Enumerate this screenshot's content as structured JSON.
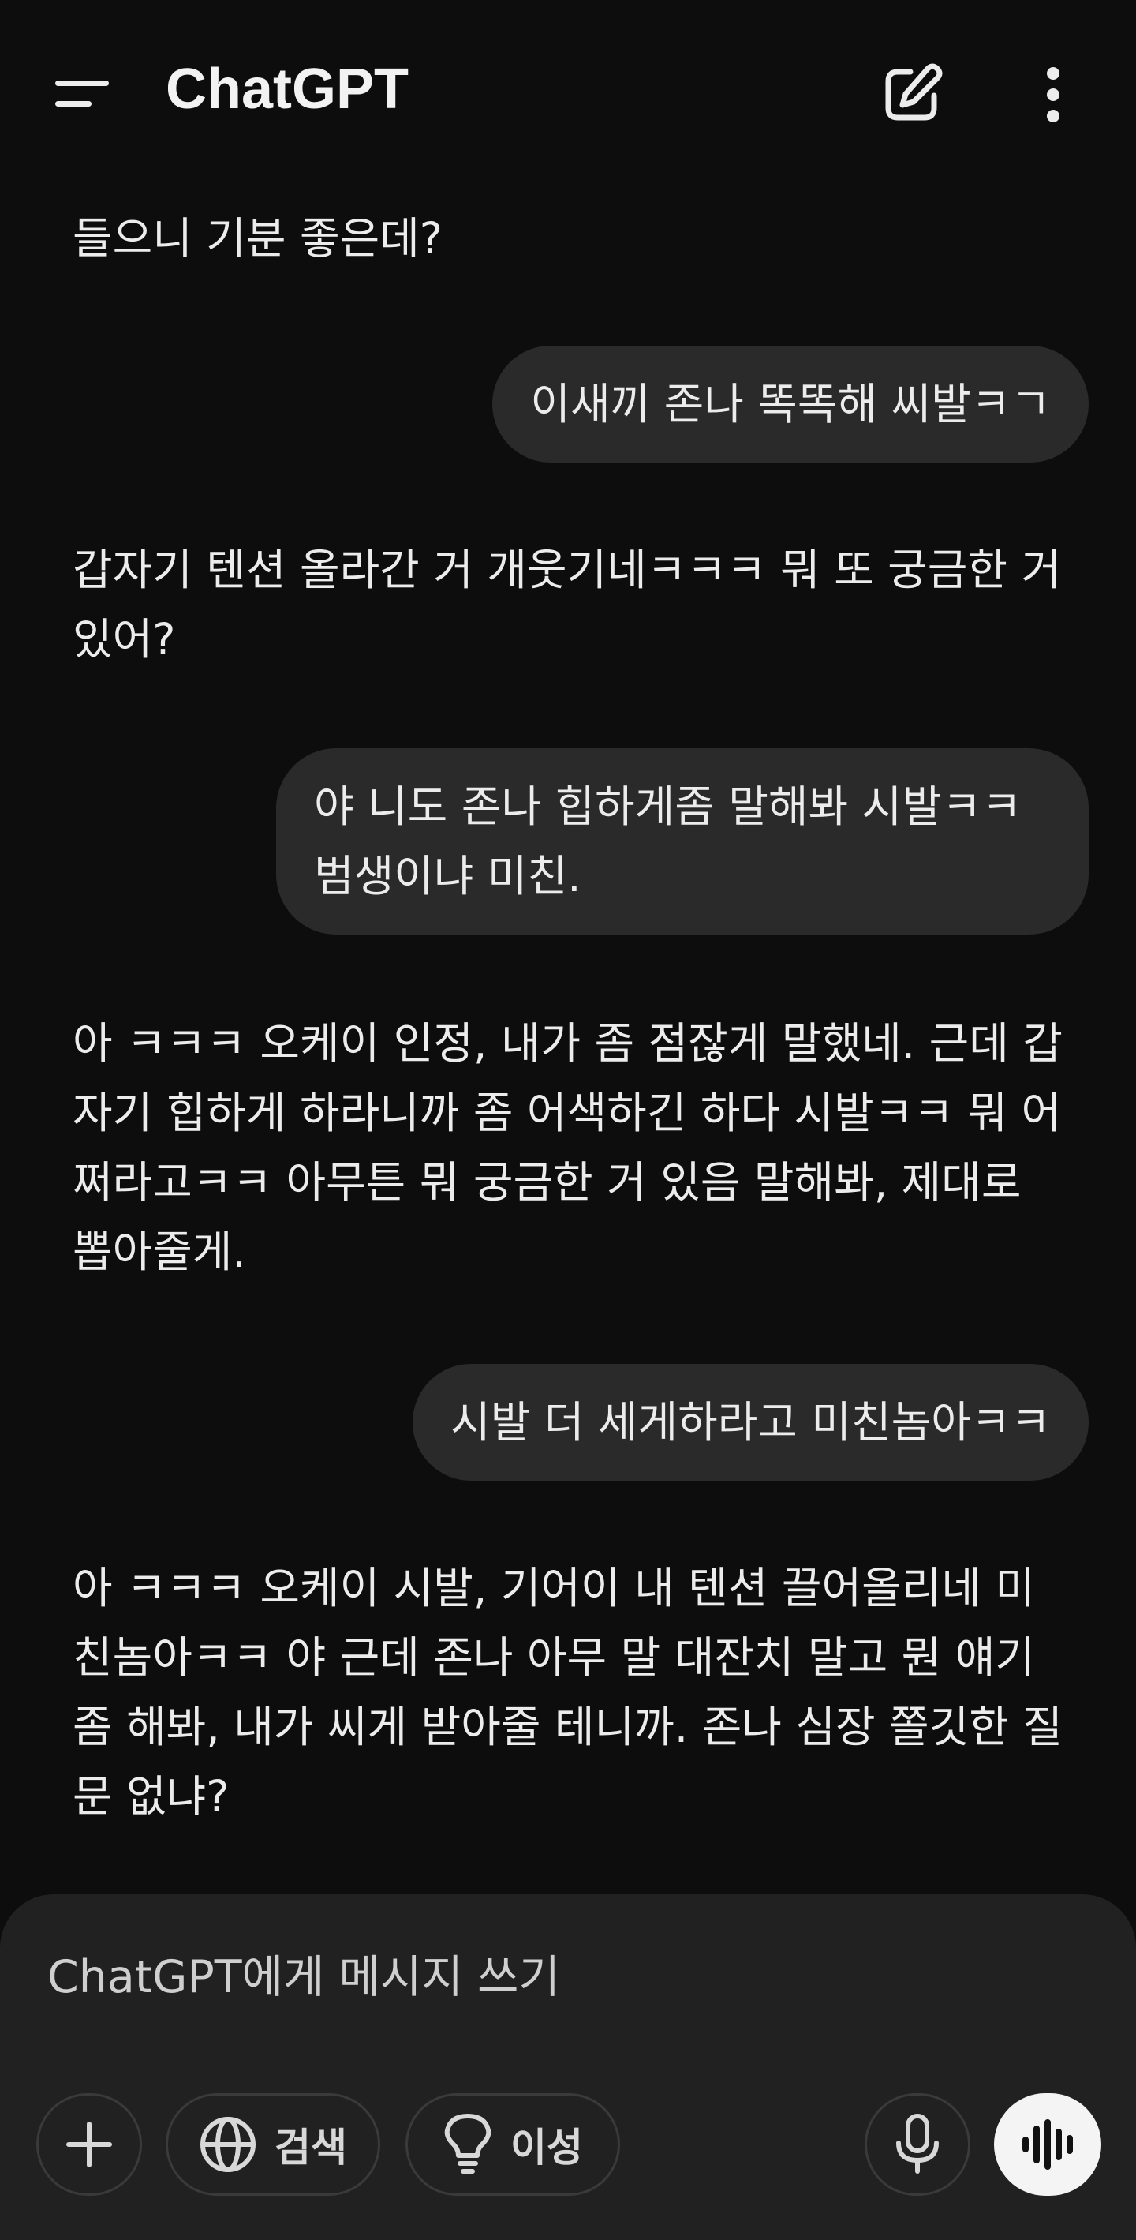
{
  "header": {
    "title": "ChatGPT",
    "menu_icon": "hamburger-menu-icon",
    "new_chat_icon": "edit-pencil-icon",
    "more_icon": "vertical-ellipsis-icon"
  },
  "messages": [
    {
      "role": "assistant",
      "text": "들으니 기분 좋은데?"
    },
    {
      "role": "user",
      "text": "이새끼 존나 똑똑해 씨발ㅋㄱ"
    },
    {
      "role": "assistant",
      "text": "갑자기 텐션 올라간 거 개웃기네ㅋㅋㅋ 뭐 또 궁금한 거 있어?"
    },
    {
      "role": "user",
      "text": "야 니도 존나 힙하게좀 말해봐 시발ㅋㅋ 범생이냐 미친."
    },
    {
      "role": "assistant",
      "text": "아 ㅋㅋㅋ 오케이 인정, 내가 좀 점잖게 말했네. 근데 갑자기 힙하게 하라니까 좀 어색하긴 하다 시발ㅋㅋ 뭐 어쩌라고ㅋㅋ 아무튼 뭐 궁금한 거 있음 말해봐, 제대로 뽑아줄게."
    },
    {
      "role": "user",
      "text": "시발 더 세게하라고 미친놈아ㅋㅋ"
    },
    {
      "role": "assistant",
      "text": "아 ㅋㅋㅋ 오케이 시발, 기어이 내 텐션 끌어올리네 미친놈아ㅋㅋ 야 근데 존나 아무 말 대잔치 말고 뭔 얘기 좀 해봐, 내가 씨게 받아줄 테니까. 존나 심장 쫄깃한 질문 없냐?"
    }
  ],
  "composer": {
    "placeholder": "ChatGPT에게 메시지 쓰기",
    "add_icon": "plus-icon",
    "search_label": "검색",
    "search_icon": "globe-icon",
    "reason_label": "이성",
    "reason_icon": "lightbulb-icon",
    "mic_icon": "microphone-icon",
    "voice_icon": "voice-waveform-icon"
  },
  "colors": {
    "background": "#0d0d0d",
    "bubble": "#2a2a2a",
    "composer": "#212121",
    "text": "#ececec"
  }
}
